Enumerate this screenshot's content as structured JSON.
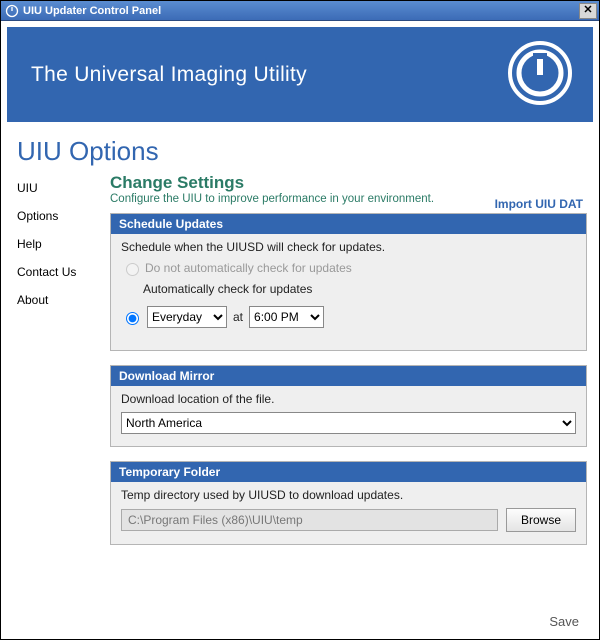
{
  "window": {
    "title": "UIU Updater Control Panel"
  },
  "banner": {
    "title": "The Universal Imaging Utility"
  },
  "page": {
    "heading": "UIU Options"
  },
  "sidebar": {
    "items": [
      {
        "label": "UIU"
      },
      {
        "label": "Options"
      },
      {
        "label": "Help"
      },
      {
        "label": "Contact Us"
      },
      {
        "label": "About"
      }
    ]
  },
  "settings": {
    "title": "Change Settings",
    "subtitle": "Configure the UIU to improve performance in your environment.",
    "import_link": "Import UIU DAT"
  },
  "schedule": {
    "header": "Schedule Updates",
    "desc": "Schedule when the UIUSD will check for updates.",
    "opt_none": "Do not automatically check for updates",
    "opt_auto": "Automatically check for updates",
    "freq_value": "Everyday",
    "at_label": "at",
    "time_value": "6:00 PM"
  },
  "mirror": {
    "header": "Download Mirror",
    "desc": "Download location of the file.",
    "value": "North America"
  },
  "temp": {
    "header": "Temporary Folder",
    "desc": "Temp directory used by UIUSD to download updates.",
    "path": "C:\\Program Files (x86)\\UIU\\temp",
    "browse": "Browse"
  },
  "footer": {
    "save": "Save"
  }
}
